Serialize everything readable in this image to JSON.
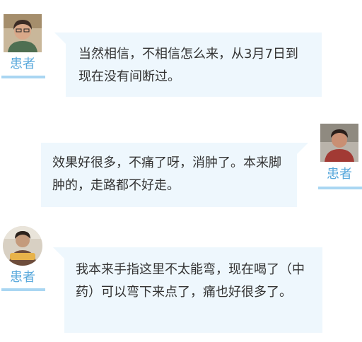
{
  "messages": [
    {
      "side": "left",
      "sender_label": "患者",
      "text": "当然相信，不相信怎么来，从3月7日到现在没有间断过。"
    },
    {
      "side": "right",
      "sender_label": "患者",
      "text": "效果好很多，不痛了呀，消肿了。本来脚肿的，走路都不好走。"
    },
    {
      "side": "left",
      "sender_label": "患者",
      "text": "我本来手指这里不太能弯，现在喝了（中药）可以弯下来点了，痛也好很多了。"
    }
  ],
  "colors": {
    "bubble": "#eef7fd",
    "label_text": "#5aa9dc",
    "label_underline": "#a9d6f2",
    "message_text": "#333333"
  }
}
